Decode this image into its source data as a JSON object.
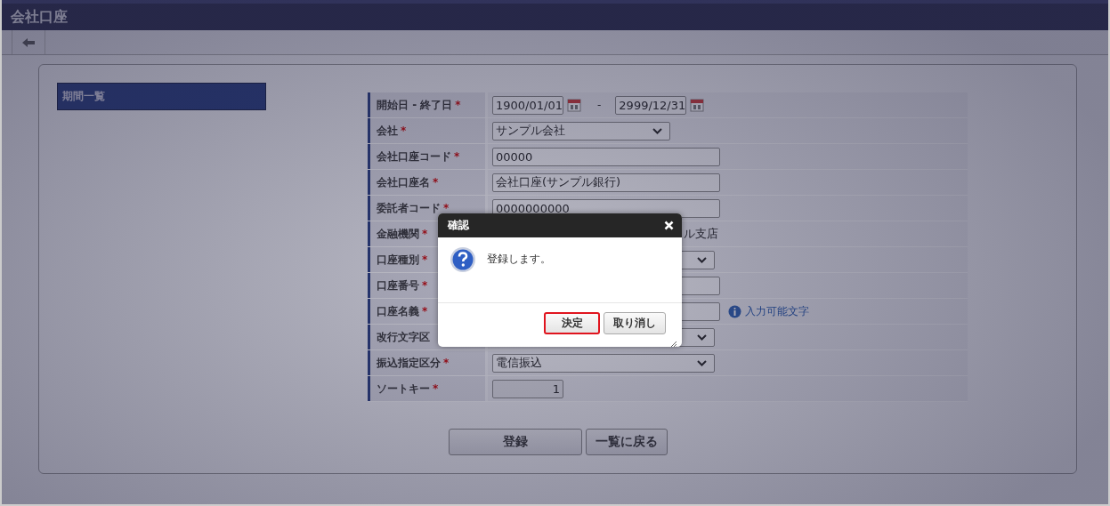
{
  "window": {
    "title": "会社口座"
  },
  "sidebar": {
    "items": [
      {
        "label": "期間一覧",
        "selected": true
      }
    ]
  },
  "form": {
    "rows": [
      {
        "label": "開始日 - 終了日",
        "required_mark": "*",
        "kind": "date_range",
        "start": "1900/01/01",
        "separator": "-",
        "end": "2999/12/31"
      },
      {
        "label": "会社",
        "required_mark": "*",
        "kind": "select",
        "value": "サンプル会社"
      },
      {
        "label": "会社口座コード",
        "required_mark": "*",
        "kind": "input",
        "value": "00000"
      },
      {
        "label": "会社口座名",
        "required_mark": "*",
        "kind": "input",
        "value": "会社口座(サンプル銀行)"
      },
      {
        "label": "委託者コード",
        "required_mark": "*",
        "kind": "input",
        "value": "0000000000"
      },
      {
        "label": "金融機関",
        "required_mark": "*",
        "kind": "text",
        "value": "ル支店"
      },
      {
        "label": "口座種別",
        "required_mark": "*",
        "kind": "select"
      },
      {
        "label": "口座番号",
        "required_mark": "*",
        "kind": "input"
      },
      {
        "label": "口座名義",
        "required_mark": "*",
        "kind": "input",
        "hint": "入力可能文字"
      },
      {
        "label": "改行文字区",
        "kind": "select"
      },
      {
        "label": "振込指定区分",
        "required_mark": "*",
        "kind": "select",
        "value": "電信振込"
      },
      {
        "label": "ソートキー",
        "required_mark": "*",
        "kind": "number",
        "value": "1"
      }
    ]
  },
  "buttons": [
    {
      "label": "登録",
      "kind": "primary"
    },
    {
      "label": "一覧に戻る",
      "kind": "secondary"
    }
  ],
  "dialog": {
    "title": "確認",
    "message": "登録します。",
    "buttons": [
      {
        "label": "決定",
        "focused": true
      },
      {
        "label": "取り消し",
        "focused": false
      }
    ]
  }
}
